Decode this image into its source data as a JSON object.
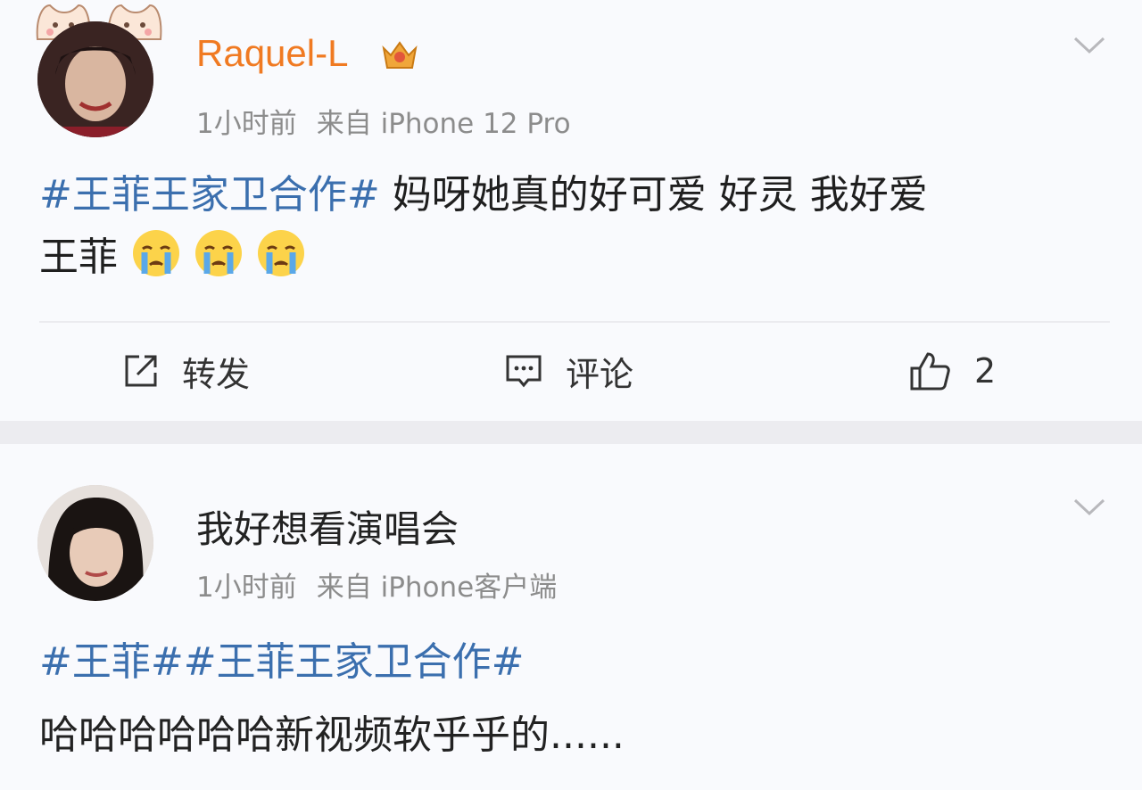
{
  "posts": [
    {
      "username": "Raquel-L",
      "time": "1小时前",
      "source": "来自 iPhone 12 Pro",
      "topic": "#王菲王家卫合作#",
      "text_line1": " 妈呀她真的好可爱 好灵 我好爱",
      "text_line2": "王菲",
      "emoji": "crying-face",
      "actions": {
        "repost_label": "转发",
        "comment_label": "评论",
        "like_count": "2"
      }
    },
    {
      "username": "我好想看演唱会",
      "time": "1小时前",
      "source": "来自 iPhone客户端",
      "topics": "#王菲##王菲王家卫合作#",
      "text": "哈哈哈哈哈哈新视频软乎乎的......"
    }
  ],
  "colors": {
    "topic_link": "#3b6fae",
    "vip_username": "#f07a22",
    "meta_text": "#8c8c8c"
  }
}
